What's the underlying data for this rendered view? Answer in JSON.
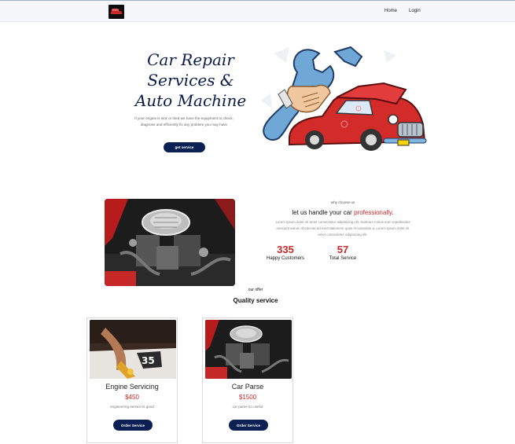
{
  "navbar": {
    "logo_icon": "car-logo-icon",
    "links": [
      "Home",
      "Login"
    ]
  },
  "hero": {
    "title_lines": [
      "Car Repair",
      "Services &",
      "Auto Machine"
    ],
    "text_lines": [
      "If your engine is sick or tired we have the equipment to check,",
      "diagnose and efficiently fix any problem you may have"
    ],
    "button_label": "get service",
    "illustration_icon": "car-repair-wrench-illustration"
  },
  "why": {
    "small_label": "why choose us",
    "heading_prefix": "let us handle your car ",
    "heading_accent": "professionally.",
    "paragraph_lines": [
      "Lorem ipsum dolor sit amet consectetur adipisicing elit. Nostrum minus eum repellendus",
      "nesciunt earum obcaecati ad exercitationem quas recusandae a. Lorem ipsum dolor sit",
      "amet consectetur adipisicing elit."
    ],
    "stats": [
      {
        "value": "335",
        "label": "Happy Customers"
      },
      {
        "value": "57",
        "label": "Total Service"
      }
    ],
    "photo_icon": "car-engine-photo"
  },
  "offer": {
    "small_label": "our offer",
    "heading": "Quality service",
    "cards": [
      {
        "title": "Engine Servicing",
        "price": "$450",
        "description": "engineering service is good",
        "button": "Order Service"
      },
      {
        "title": "Car Parse",
        "price": "$1500",
        "description": "car parse so useful",
        "button": "Order Service"
      }
    ]
  },
  "colors": {
    "primary": "#0b2154",
    "accent": "#c62828",
    "title": "#0c1d4a"
  }
}
